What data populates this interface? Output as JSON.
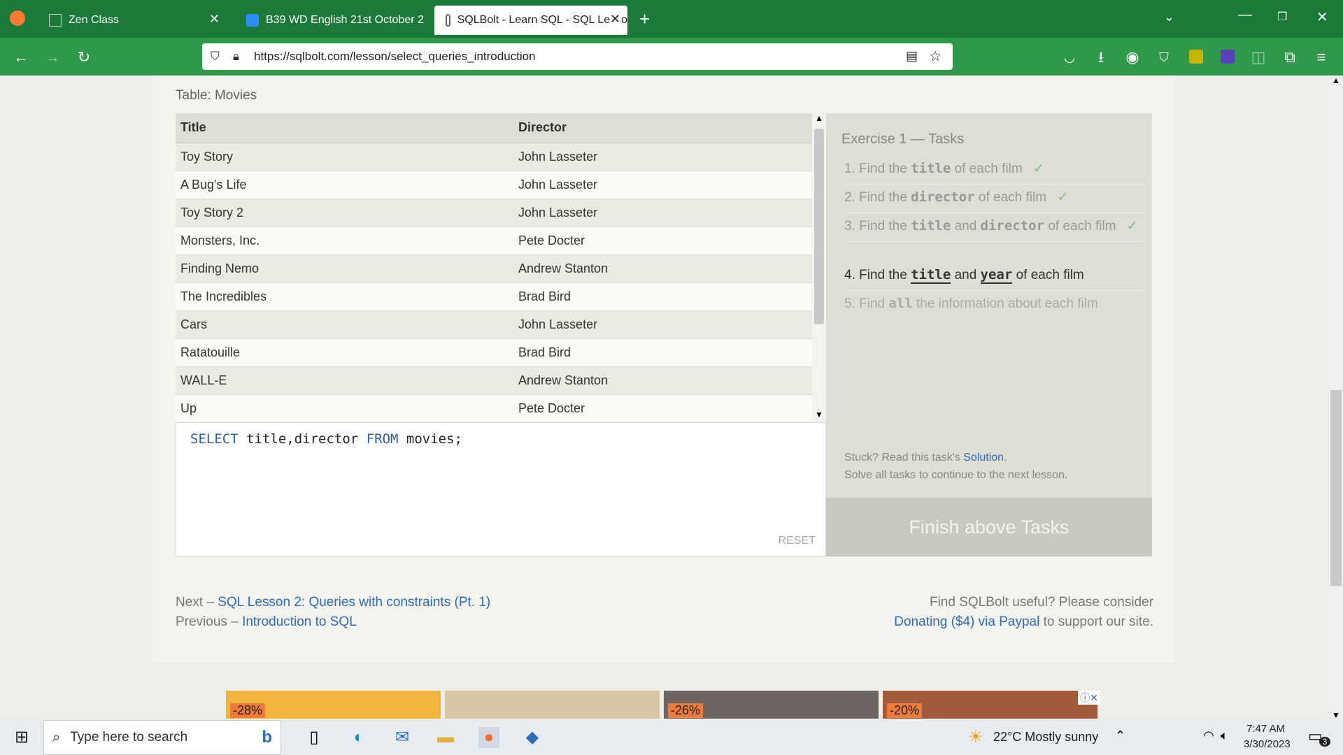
{
  "browser": {
    "tabs": [
      {
        "label": "Zen Class"
      },
      {
        "label": "B39 WD English 21st October 2"
      },
      {
        "label": "SQLBolt - Learn SQL - SQL Lesso"
      }
    ],
    "url": "https://sqlbolt.com/lesson/select_queries_introduction"
  },
  "table": {
    "label": "Table: Movies",
    "headers": [
      "Title",
      "Director"
    ],
    "rows": [
      [
        "Toy Story",
        "John Lasseter"
      ],
      [
        "A Bug's Life",
        "John Lasseter"
      ],
      [
        "Toy Story 2",
        "John Lasseter"
      ],
      [
        "Monsters, Inc.",
        "Pete Docter"
      ],
      [
        "Finding Nemo",
        "Andrew Stanton"
      ],
      [
        "The Incredibles",
        "Brad Bird"
      ],
      [
        "Cars",
        "John Lasseter"
      ],
      [
        "Ratatouille",
        "Brad Bird"
      ],
      [
        "WALL-E",
        "Andrew Stanton"
      ],
      [
        "Up",
        "Pete Docter"
      ]
    ]
  },
  "editor": {
    "kw1": "SELECT",
    "t1": "title,director",
    "kw2": "FROM",
    "t2": "movies;",
    "reset": "RESET"
  },
  "tasks": {
    "title": "Exercise 1 — Tasks",
    "items": [
      {
        "num": "1.",
        "pre": "Find the",
        "c1": "title",
        "mid": "",
        "c2": "",
        "post": "of each film",
        "check": "✓"
      },
      {
        "num": "2.",
        "pre": "Find the",
        "c1": "director",
        "mid": "",
        "c2": "",
        "post": "of each film",
        "check": "✓"
      },
      {
        "num": "3.",
        "pre": "Find the",
        "c1": "title",
        "mid": "and",
        "c2": "director",
        "post": "of each film",
        "check": "✓"
      },
      {
        "num": "4.",
        "pre": "Find the",
        "c1": "title",
        "mid": "and",
        "c2": "year",
        "post": "of each film",
        "check": ""
      },
      {
        "num": "5.",
        "pre": "Find",
        "c1": "all",
        "mid": "",
        "c2": "",
        "post": "the information about each film",
        "check": ""
      }
    ],
    "stuck": "Stuck? Read this task's",
    "solution": "Solution",
    "solve": "Solve all tasks to continue to the next lesson.",
    "finish": "Finish above Tasks"
  },
  "footer": {
    "next_pre": "Next –",
    "next_link": "SQL Lesson 2: Queries with constraints (Pt. 1)",
    "prev_pre": "Previous –",
    "prev_link": "Introduction to SQL",
    "useful": "Find SQLBolt useful? Please consider",
    "donate": "Donating ($4) via Paypal",
    "support": "to support our site."
  },
  "ads": [
    "-28%",
    "",
    "-26%",
    "-20%"
  ],
  "taskbar": {
    "search": "Type here to search",
    "weather": "22°C  Mostly sunny",
    "time": "7:47 AM",
    "date": "3/30/2023",
    "notif": "3"
  }
}
